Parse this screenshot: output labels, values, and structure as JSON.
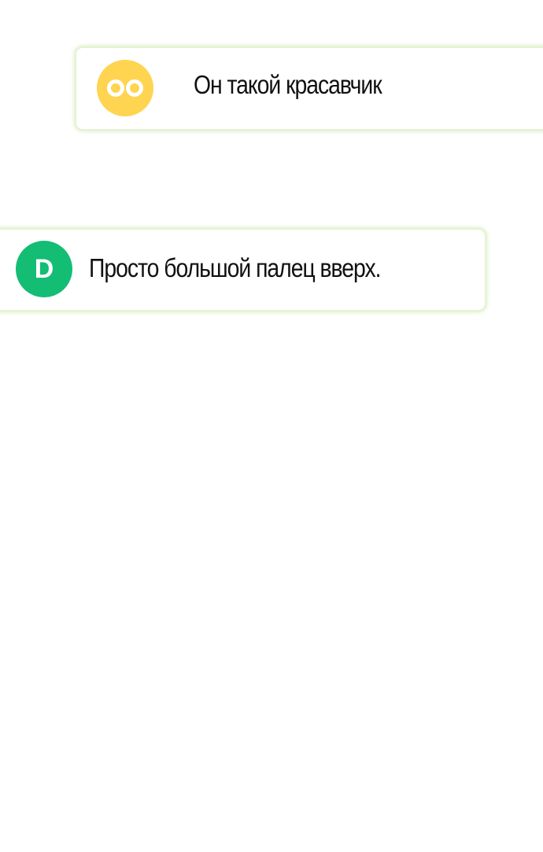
{
  "messages": [
    {
      "avatar_icon": "eyes-icon",
      "avatar_color": "#ffd451",
      "text": "Он такой красавчик"
    },
    {
      "avatar_letter": "D",
      "avatar_color": "#14bd74",
      "text": "Просто большой палец вверх."
    }
  ],
  "colors": {
    "bubble_border": "#e6f2d4",
    "background": "#ffffff",
    "text": "#111111"
  }
}
